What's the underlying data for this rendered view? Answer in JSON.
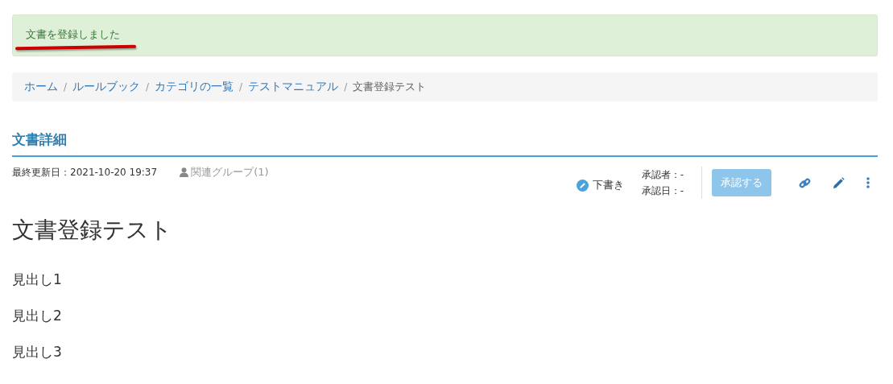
{
  "alert": {
    "message": "文書を登録しました",
    "underlined": true
  },
  "breadcrumb_separator": "/",
  "breadcrumb": [
    {
      "label": "ホーム",
      "current": false
    },
    {
      "label": "ルールブック",
      "current": false
    },
    {
      "label": "カテゴリの一覧",
      "current": false
    },
    {
      "label": "テストマニュアル",
      "current": false
    },
    {
      "label": "文書登録テスト",
      "current": true
    }
  ],
  "section_title": "文書詳細",
  "meta": {
    "updated": "最終更新日：2021-10-20 19:37",
    "groups": "関連グループ(1)"
  },
  "status": {
    "label": "下書き",
    "approver": "承認者：-",
    "approved_date": "承認日：-"
  },
  "approve_button": {
    "label": "承認する",
    "disabled": true
  },
  "document": {
    "title": "文書登録テスト",
    "headings": [
      "見出し1",
      "見出し2",
      "見出し3"
    ]
  }
}
